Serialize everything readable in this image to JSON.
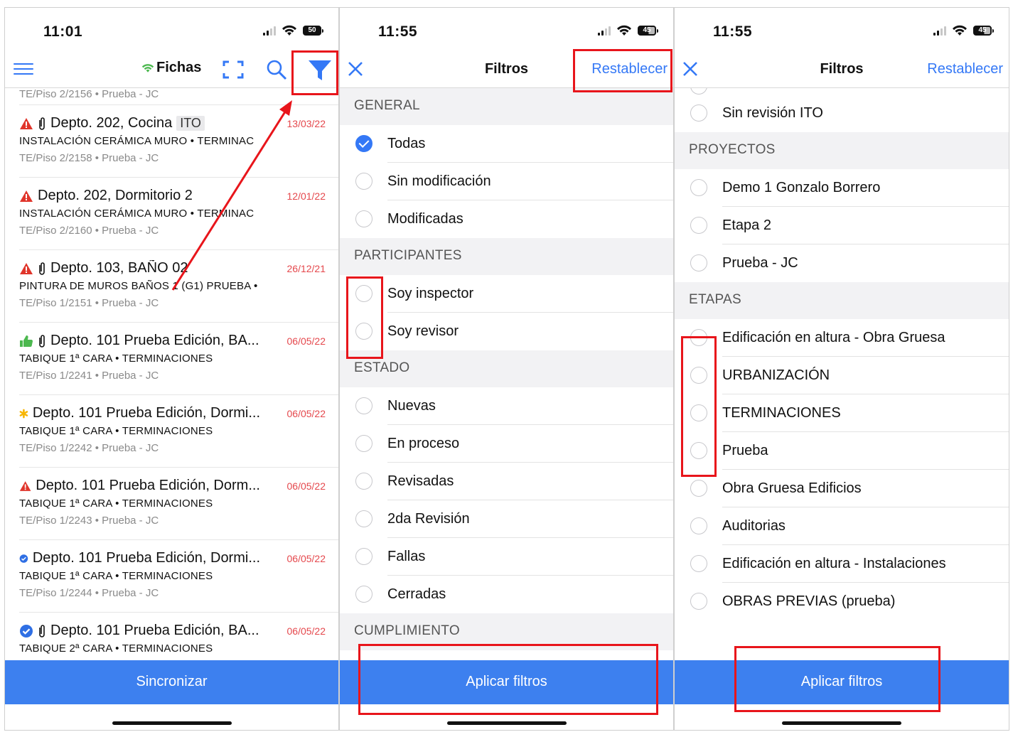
{
  "screen1": {
    "status": {
      "time": "11:01",
      "battery": "50"
    },
    "nav": {
      "title": "Fichas"
    },
    "records": [
      {
        "title": "",
        "tag": "",
        "date": "",
        "subtitle": "",
        "meta": "TE/Piso 2/2156 • Prueba - JC",
        "icon": "",
        "clip": false
      },
      {
        "title": "Depto. 202, Cocina",
        "tag": "ITO",
        "date": "13/03/22",
        "subtitle": "INSTALACIÓN CERÁMICA MURO • TERMINAC",
        "meta": "TE/Piso 2/2158 • Prueba - JC",
        "icon": "warning-icon",
        "clip": true
      },
      {
        "title": "Depto. 202, Dormitorio 2",
        "tag": "",
        "date": "12/01/22",
        "subtitle": "INSTALACIÓN CERÁMICA MURO • TERMINAC",
        "meta": "TE/Piso 2/2160 • Prueba - JC",
        "icon": "warning-icon",
        "clip": false
      },
      {
        "title": "Depto. 103, BAÑO 02",
        "tag": "",
        "date": "26/12/21",
        "subtitle": "PINTURA DE MUROS BAÑOS 1 (G1) PRUEBA •",
        "meta": "TE/Piso 1/2151 • Prueba - JC",
        "icon": "warning-icon",
        "clip": true
      },
      {
        "title": "Depto. 101 Prueba Edición, BA...",
        "tag": "",
        "date": "06/05/22",
        "subtitle": "TABIQUE 1ª CARA • TERMINACIONES",
        "meta": "TE/Piso 1/2241 • Prueba - JC",
        "icon": "thumbs-up-icon",
        "clip": true
      },
      {
        "title": "Depto. 101 Prueba Edición, Dormi...",
        "tag": "",
        "date": "06/05/22",
        "subtitle": "TABIQUE 1ª CARA • TERMINACIONES",
        "meta": "TE/Piso 1/2242 • Prueba - JC",
        "icon": "asterisk-icon",
        "clip": false
      },
      {
        "title": "Depto. 101 Prueba Edición, Dorm...",
        "tag": "",
        "date": "06/05/22",
        "subtitle": "TABIQUE 1ª CARA • TERMINACIONES",
        "meta": "TE/Piso 1/2243 • Prueba - JC",
        "icon": "warning-icon",
        "clip": false
      },
      {
        "title": "Depto. 101 Prueba Edición, Dormi...",
        "tag": "",
        "date": "06/05/22",
        "subtitle": "TABIQUE 1ª CARA • TERMINACIONES",
        "meta": "TE/Piso 1/2244 • Prueba - JC",
        "icon": "check-badge-icon",
        "clip": false
      },
      {
        "title": "Depto. 101 Prueba Edición, BA...",
        "tag": "",
        "date": "06/05/22",
        "subtitle": "TABIQUE 2ª CARA • TERMINACIONES",
        "meta": "",
        "icon": "check-badge-icon",
        "clip": true
      }
    ],
    "sync_button": "Sincronizar"
  },
  "screen2": {
    "status": {
      "time": "11:55",
      "battery": "45"
    },
    "nav": {
      "title": "Filtros",
      "reset": "Restablecer"
    },
    "sections": [
      {
        "header": "GENERAL",
        "options": [
          {
            "label": "Todas",
            "checked": true
          },
          {
            "label": "Sin modificación",
            "checked": false
          },
          {
            "label": "Modificadas",
            "checked": false
          }
        ]
      },
      {
        "header": "PARTICIPANTES",
        "options": [
          {
            "label": "Soy inspector",
            "checked": false
          },
          {
            "label": "Soy revisor",
            "checked": false
          }
        ]
      },
      {
        "header": "ESTADO",
        "options": [
          {
            "label": "Nuevas",
            "checked": false
          },
          {
            "label": "En proceso",
            "checked": false
          },
          {
            "label": "Revisadas",
            "checked": false
          },
          {
            "label": "2da Revisión",
            "checked": false
          },
          {
            "label": "Fallas",
            "checked": false
          },
          {
            "label": "Cerradas",
            "checked": false
          }
        ]
      },
      {
        "header": "CUMPLIMIENTO",
        "options": []
      }
    ],
    "apply_button": "Aplicar filtros"
  },
  "screen3": {
    "status": {
      "time": "11:55",
      "battery": "45"
    },
    "nav": {
      "title": "Filtros",
      "reset": "Restablecer"
    },
    "sections": [
      {
        "header": "",
        "options": [
          {
            "label": "Sin revisión ITO",
            "checked": false
          }
        ]
      },
      {
        "header": "PROYECTOS",
        "options": [
          {
            "label": "Demo 1 Gonzalo Borrero",
            "checked": false
          },
          {
            "label": "Etapa 2",
            "checked": false
          },
          {
            "label": "Prueba - JC",
            "checked": false
          }
        ]
      },
      {
        "header": "ETAPAS",
        "options": [
          {
            "label": "Edificación en altura - Obra Gruesa",
            "checked": false
          },
          {
            "label": "URBANIZACIÓN",
            "checked": false
          },
          {
            "label": "TERMINACIONES",
            "checked": false
          },
          {
            "label": "Prueba",
            "checked": false
          },
          {
            "label": "Obra Gruesa Edificios",
            "checked": false
          },
          {
            "label": "Auditorias",
            "checked": false
          },
          {
            "label": "Edificación en altura - Instalaciones",
            "checked": false
          },
          {
            "label": "OBRAS PREVIAS (prueba)",
            "checked": false
          }
        ]
      }
    ],
    "apply_button": "Aplicar filtros"
  },
  "colors": {
    "accent": "#3478f6",
    "button": "#3d80ef",
    "highlight": "#e8151b",
    "date": "#e5484d",
    "warning": "#e0352b",
    "thumbs": "#4cb84f",
    "asterisk": "#f7b500"
  }
}
